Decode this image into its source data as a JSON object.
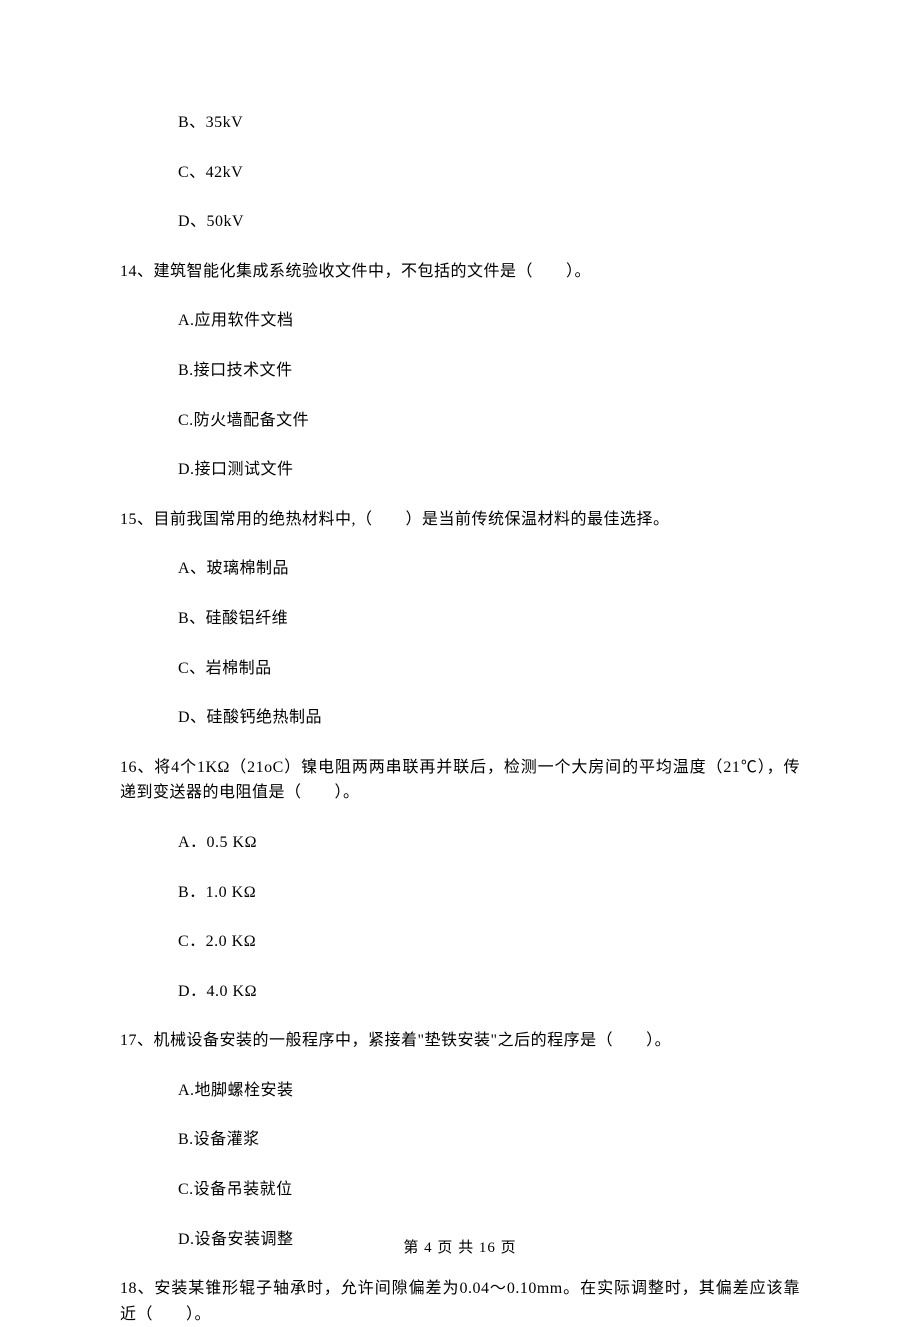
{
  "q13_options": {
    "b": "B、35kV",
    "c": "C、42kV",
    "d": "D、50kV"
  },
  "q14": {
    "stem": "14、建筑智能化集成系统验收文件中，不包括的文件是（　　）。",
    "a": "A.应用软件文档",
    "b": "B.接口技术文件",
    "c": "C.防火墙配备文件",
    "d": "D.接口测试文件"
  },
  "q15": {
    "stem": "15、目前我国常用的绝热材料中,（　　）是当前传统保温材料的最佳选择。",
    "a": "A、玻璃棉制品",
    "b": "B、硅酸铝纤维",
    "c": "C、岩棉制品",
    "d": "D、硅酸钙绝热制品"
  },
  "q16": {
    "stem": "16、将4个1KΩ（21oC）镍电阻两两串联再并联后，检测一个大房间的平均温度（21℃），传递到变送器的电阻值是（　　）。",
    "a": "A．0.5 KΩ",
    "b": "B．1.0 KΩ",
    "c": "C．2.0 KΩ",
    "d": "D．4.0 KΩ"
  },
  "q17": {
    "stem": "17、机械设备安装的一般程序中，紧接着\"垫铁安装\"之后的程序是（　　）。",
    "a": "A.地脚螺栓安装",
    "b": "B.设备灌浆",
    "c": "C.设备吊装就位",
    "d": "D.设备安装调整"
  },
  "q18": {
    "stem": "18、安装某锥形辊子轴承时，允许间隙偏差为0.04～0.10mm。在实际调整时，其偏差应该靠近（　　）。"
  },
  "footer": "第 4 页 共 16 页"
}
